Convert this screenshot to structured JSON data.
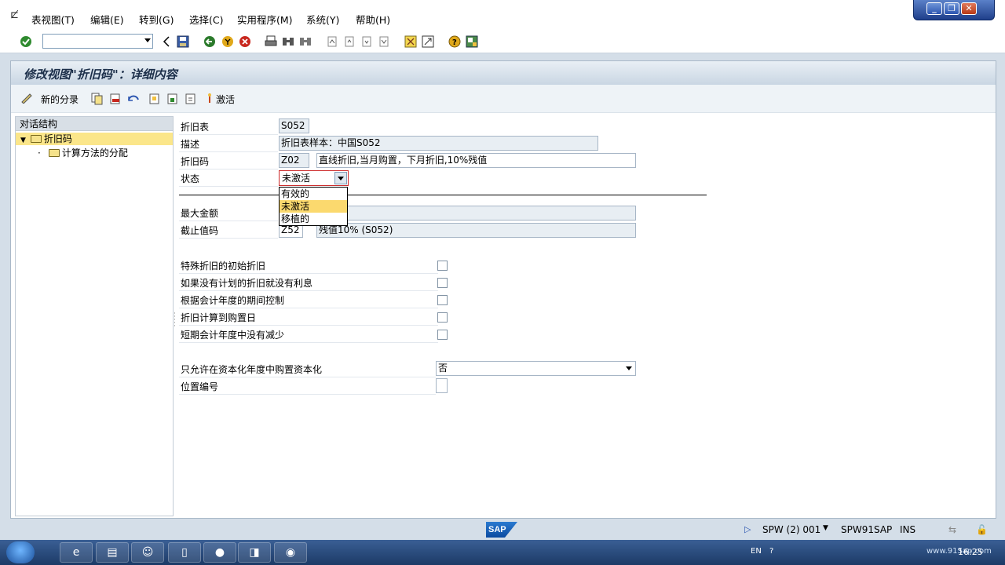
{
  "menu": {
    "items": [
      "表视图(T)",
      "编辑(E)",
      "转到(G)",
      "选择(C)",
      "实用程序(M)",
      "系统(Y)",
      "帮助(H)"
    ]
  },
  "window_controls": {
    "minimize": "_",
    "restore": "❐",
    "close": "✕"
  },
  "title": "修改视图\"折旧码\"：详细内容",
  "app_toolbar": {
    "new_entry_label": "新的分录",
    "activate_label": "激活"
  },
  "tree": {
    "header": "对话结构",
    "nodes": [
      "折旧码",
      "计算方法的分配"
    ]
  },
  "form": {
    "depr_table_label": "折旧表",
    "depr_table_value": "S052",
    "desc_label": "描述",
    "desc_value": "折旧表样本：中国S052",
    "depr_key_label": "折旧码",
    "depr_key_value": "Z02",
    "depr_key_text": "直线折旧,当月购置，下月折旧,10%残值",
    "status_label": "状态",
    "status_value": "未激活",
    "status_options": [
      "有效的",
      "未激活",
      "移植的"
    ],
    "max_amount_label": "最大金额",
    "cutoff_label": "截止值码",
    "cutoff_value": "Z52",
    "cutoff_text": "残值10% (S052)",
    "checkboxes": [
      "特殊折旧的初始折旧",
      "如果没有计划的折旧就没有利息",
      "根据会计年度的期间控制",
      "折旧计算到购置日",
      "短期会计年度中没有减少"
    ],
    "capitalize_label": "只允许在资本化年度中购置资本化",
    "capitalize_value": "否",
    "position_label": "位置编号"
  },
  "statusbar": {
    "sap_logo": "SAP",
    "system": "SPW (2) 001",
    "server": "SPW91SAP",
    "mode": "INS"
  },
  "taskbar": {
    "lang": "EN",
    "clock": "16:25",
    "watermark": "www.91Sap.com"
  }
}
